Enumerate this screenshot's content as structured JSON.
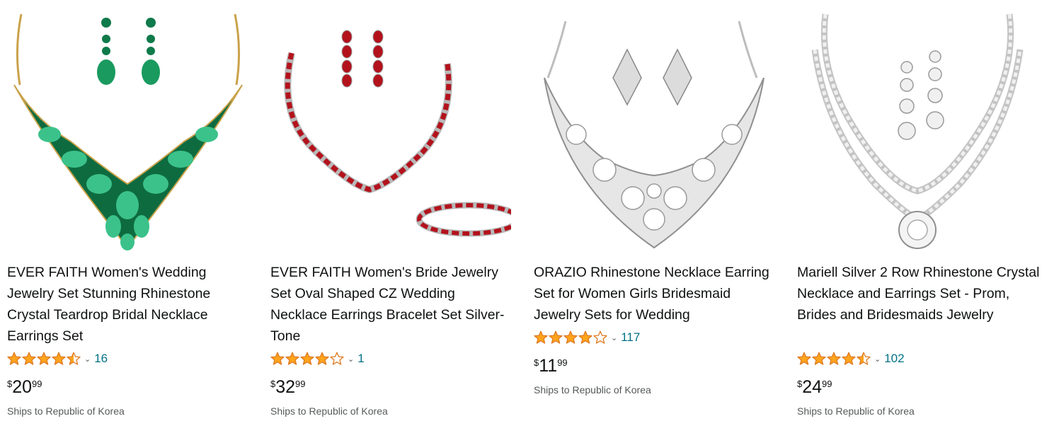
{
  "products": [
    {
      "title": "EVER FAITH Women's Wedding Jewelry Set Stunning Rhinestone Crystal Teardrop Bridal Necklace Earrings Set",
      "rating": 4.5,
      "review_count": "16",
      "price_symbol": "$",
      "price_whole": "20",
      "price_fraction": "99",
      "shipping": "Ships to Republic of Korea",
      "image_colors": {
        "gem": "#0f7a4a",
        "gem_light": "#3bc28a",
        "metal": "#c9a24a"
      }
    },
    {
      "title": "EVER FAITH Women's Bride Jewelry Set Oval Shaped CZ Wedding Necklace Earrings Bracelet Set Silver-Tone",
      "rating": 4.0,
      "review_count": "1",
      "price_symbol": "$",
      "price_whole": "32",
      "price_fraction": "99",
      "shipping": "Ships to Republic of Korea",
      "image_colors": {
        "gem": "#b3121c",
        "gem_light": "#e04a52",
        "metal": "#b8b8b8"
      }
    },
    {
      "title": "ORAZIO Rhinestone Necklace Earring Set for Women Girls Bridesmaid Jewelry Sets for Wedding",
      "rating": 4.0,
      "review_count": "117",
      "price_symbol": "$",
      "price_whole": "11",
      "price_fraction": "99",
      "shipping": "Ships to Republic of Korea",
      "image_colors": {
        "gem": "#9a9a9a",
        "gem_light": "#e8e8e8",
        "metal": "#bdbdbd"
      }
    },
    {
      "title": "Mariell Silver 2 Row Rhinestone Crystal Necklace and Earrings Set - Prom, Brides and Bridesmaids Jewelry",
      "rating": 4.5,
      "review_count": "102",
      "price_symbol": "$",
      "price_whole": "24",
      "price_fraction": "99",
      "shipping": "Ships to Republic of Korea",
      "image_colors": {
        "gem": "#a8a8a8",
        "gem_light": "#f0f0f0",
        "metal": "#c4c4c4"
      }
    }
  ],
  "colors": {
    "star": "#ffa41c",
    "star_empty": "#ffffff",
    "link": "#007185",
    "muted": "#565959"
  },
  "icons": {
    "rating_popover": "chevron-down-icon",
    "star": "star-icon"
  }
}
